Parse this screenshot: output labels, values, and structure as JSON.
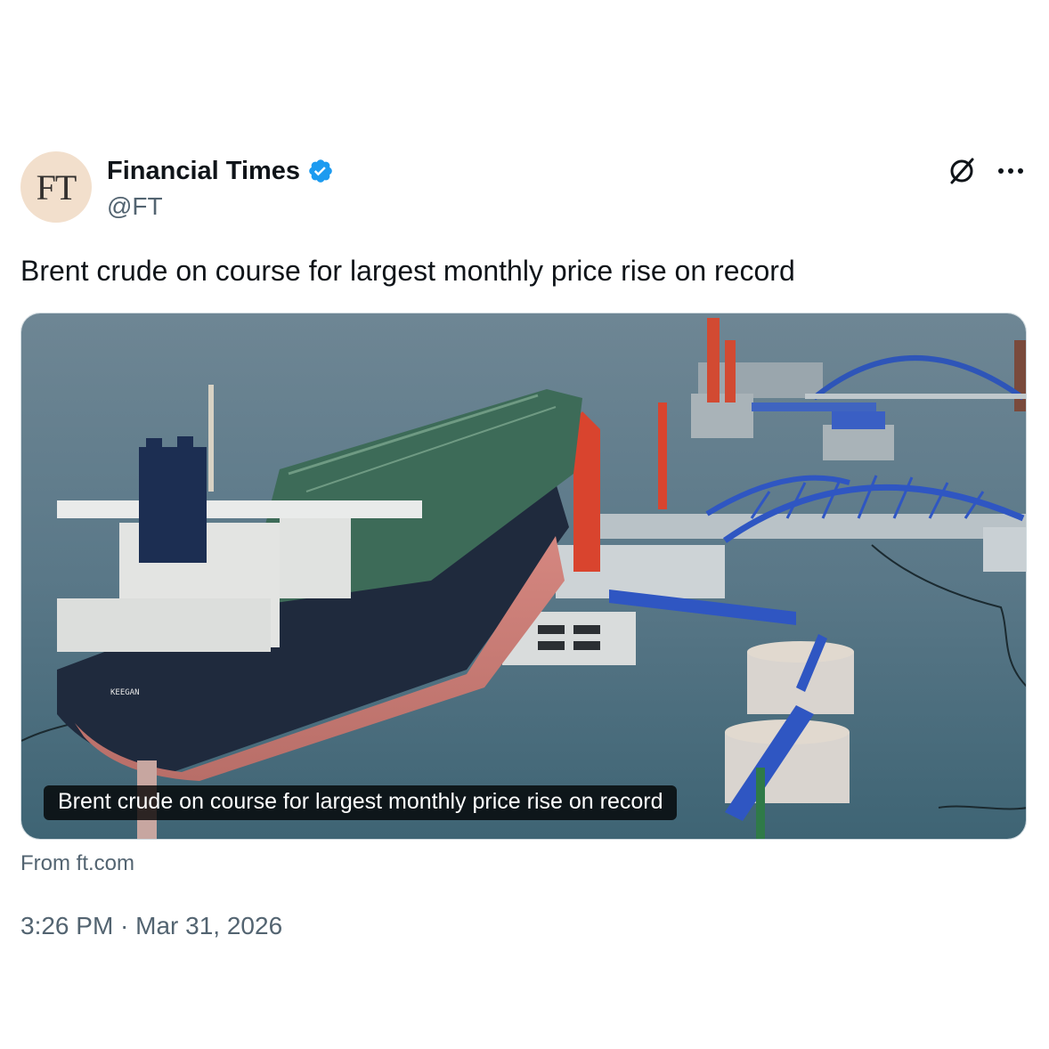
{
  "author": {
    "avatar_text": "FT",
    "display_name": "Financial Times",
    "handle": "@FT",
    "verified": true
  },
  "header_icons": {
    "grok": "grok-slashed-circle-icon",
    "more": "more-horizontal-icon"
  },
  "tweet": {
    "text": "Brent crude on course for largest monthly price rise on record"
  },
  "media": {
    "image_subject": "Oil tanker KEEGAN docked at offshore oil terminal with blue arched trestle bridges",
    "hull_text": "KEEGAN",
    "caption": "Brent crude on course for largest monthly price rise on record"
  },
  "source": "From ft.com",
  "timestamp": "3:26 PM · Mar 31, 2026",
  "colors": {
    "text_primary": "#0f1419",
    "text_secondary": "#536471",
    "verified_blue": "#1d9bf0",
    "avatar_bg": "#f2dfcc",
    "border": "#cfd9de"
  }
}
